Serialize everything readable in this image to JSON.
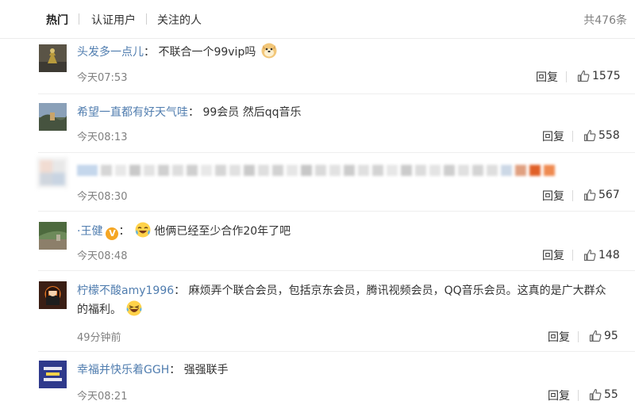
{
  "tabs": {
    "hot": "热门",
    "verified": "认证用户",
    "following": "关注的人",
    "total": "共476条"
  },
  "comments": [
    {
      "user": "头发多一点儿",
      "sep": "：",
      "text": "不联合一个99vip吗",
      "time": "今天07:53",
      "reply": "回复",
      "likes": "1575",
      "emoji": "doge-emoji"
    },
    {
      "user": "希望一直都有好天气哇",
      "sep": "：",
      "text": "99会员 然后qq音乐",
      "time": "今天08:13",
      "reply": "回复",
      "likes": "558"
    },
    {
      "time": "今天08:30",
      "reply": "回复",
      "likes": "567"
    },
    {
      "user": "·王健",
      "sep": "：",
      "text": "他俩已经至少合作20年了吧",
      "time": "今天08:48",
      "reply": "回复",
      "likes": "148",
      "badge": "V",
      "emoji": "cry-laugh-emoji"
    },
    {
      "user": "柠檬不酸amy1996",
      "sep": "：",
      "text": "麻烦弄个联合会员，包括京东会员，腾讯视频会员，QQ音乐会员。这真的是广大群众",
      "text2": "的福利。",
      "time": "49分钟前",
      "reply": "回复",
      "likes": "95",
      "emoji": "laugh-tears-emoji"
    },
    {
      "user": "幸福并快乐着GGH",
      "sep": "：",
      "text": "强强联手",
      "time": "今天08:21",
      "reply": "回复",
      "likes": "55"
    }
  ],
  "colors": {
    "username": "#507daf",
    "time": "#808080",
    "badge": "#f5a623"
  }
}
